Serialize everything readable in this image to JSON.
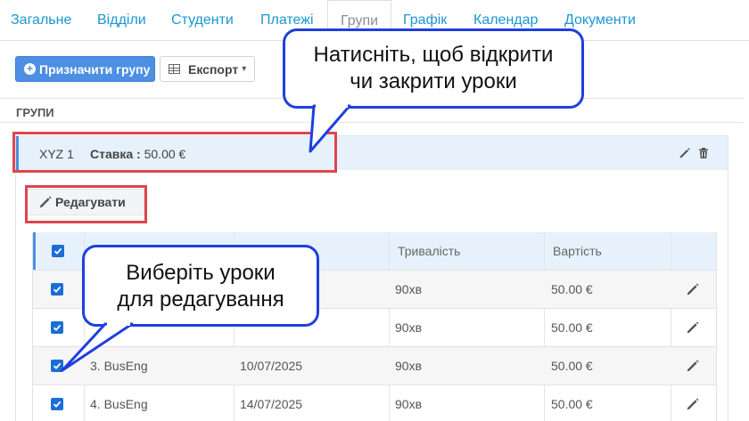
{
  "tabs": [
    {
      "label": "Загальне"
    },
    {
      "label": "Відділи"
    },
    {
      "label": "Студенти"
    },
    {
      "label": "Платежі"
    },
    {
      "label": "Групи",
      "active": true
    },
    {
      "label": "Графік"
    },
    {
      "label": "Календар"
    },
    {
      "label": "Документи"
    }
  ],
  "toolbar": {
    "assign_group_label": "Призначити групу",
    "export_label": "Експорт"
  },
  "section": {
    "title": "ГРУПИ"
  },
  "group": {
    "name": "XYZ 1",
    "rate_label": "Ставка :",
    "rate_value": "50.00 €",
    "edit_label": "Редагувати"
  },
  "lessons_table": {
    "columns": [
      "",
      "",
      "",
      "Тривалість",
      "Вартість",
      ""
    ],
    "rows": [
      {
        "checked": true,
        "lesson": "",
        "date": "",
        "duration": "90хв",
        "price": "50.00 €"
      },
      {
        "checked": true,
        "lesson": "",
        "date": "",
        "duration": "90хв",
        "price": "50.00 €"
      },
      {
        "checked": true,
        "lesson": "3. BusEng",
        "date": "10/07/2025",
        "duration": "90хв",
        "price": "50.00 €"
      },
      {
        "checked": true,
        "lesson": "4. BusEng",
        "date": "14/07/2025",
        "duration": "90хв",
        "price": "50.00 €"
      }
    ]
  },
  "callouts": {
    "toggle_lessons": [
      "Натисніть, щоб відкрити",
      "чи закрити уроки"
    ],
    "select_lessons": [
      "Виберіть уроки",
      "для редагування"
    ]
  },
  "colors": {
    "link": "#1a97d2",
    "primary": "#4d8fe2",
    "highlight_box": "#e0444e",
    "callout_border": "#1e3fe0",
    "checkbox": "#1a6fd6"
  },
  "icons": {
    "assign": "plus-circle-icon",
    "export": "table-icon",
    "edit": "pencil-icon",
    "delete": "trash-icon",
    "checkbox": "check-icon"
  }
}
